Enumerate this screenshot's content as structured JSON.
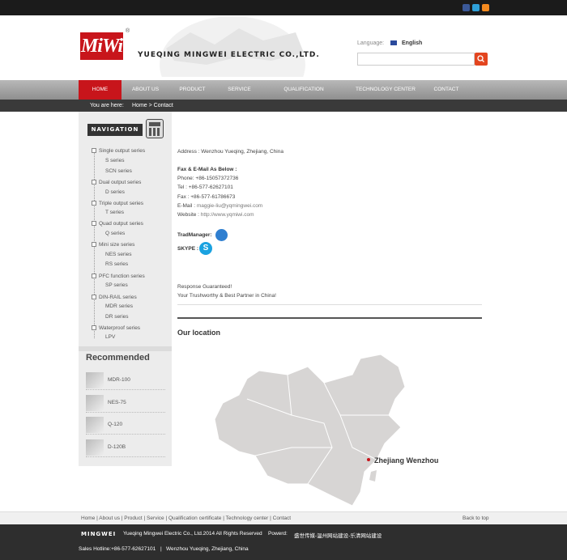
{
  "social": {
    "icons": [
      "facebook-icon",
      "twitter-icon",
      "rss-icon"
    ],
    "colors": [
      "#3b5998",
      "#2fa0d8",
      "#f58a1f"
    ]
  },
  "header": {
    "logo_text": "MiWi",
    "registered_mark": "®",
    "company_name": "YUEQING MINGWEI ELECTRIC CO.,LTD.",
    "language_label": "Language:",
    "language_value": "English",
    "search_placeholder": ""
  },
  "nav": {
    "items": [
      "HOME",
      "ABOUT US",
      "PRODUCT",
      "SERVICE",
      "QUALIFICATION CERTIFICATE",
      "TECHNOLOGY CENTER",
      "CONTACT"
    ],
    "active": "HOME",
    "accent": "#c8151b"
  },
  "breadcrumb": {
    "label": "You are here:",
    "path": "Home > Contact"
  },
  "sidebar": {
    "navigation_title": "NAVIGATION",
    "categories": [
      {
        "name": "Single output series",
        "children": [
          "S series",
          "SCN series"
        ]
      },
      {
        "name": "Dual output series",
        "children": [
          "D series"
        ]
      },
      {
        "name": "Triple output series",
        "children": [
          "T series"
        ]
      },
      {
        "name": "Quad output series",
        "children": [
          "Q series"
        ]
      },
      {
        "name": "Mini size series",
        "children": [
          "NES series",
          "RS series"
        ]
      },
      {
        "name": "PFC function series",
        "children": [
          "SP series"
        ]
      },
      {
        "name": "DIN-RAIL series",
        "children": [
          "MDR series",
          "DR series"
        ]
      },
      {
        "name": "Waterproof series",
        "children": [
          "LPV"
        ]
      }
    ],
    "recommended_title": "Recommended",
    "recommended": [
      "MDR-100",
      "NES-75",
      "Q-120",
      "D-120B"
    ]
  },
  "contact": {
    "address": "Address : Wenzhou Yueqing, Zhejiang, China",
    "fax_email_title": "Fax & E-Mail As Below :",
    "phone": "Phone: +86-15057372736",
    "tel": "Tel : +86-577-62627101",
    "fax": "Fax : +86-577-61786673",
    "email_label": "E-Mail :",
    "email": "maggie-liu@yqmingwei.com",
    "website_label": "Website :",
    "website": "http://www.yqmiwi.com",
    "tradmanager": "TradManager:",
    "skype": "SKYPE :",
    "response1": "Response Guaranteed!",
    "response2": "Your Trushworthy & Best Partner in China!",
    "location_title": "Our location",
    "city": "Zhejiang Wenzhou"
  },
  "footer": {
    "links": [
      "Home",
      "About us",
      "Product",
      "Service",
      "Qualification certificate",
      "Technology center",
      "Contact"
    ],
    "back_to_top": "Back to top",
    "brand": "MINGWEI",
    "copyright": "Yueqing Mingwei Electric Co., Ltd.2014 All Rights Reserved",
    "powered_label": "Powerd:",
    "powered_value": "盛世传媒-温州网站建设-乐清网站建设",
    "hotline": "Sales Hotline:+86-577-62627101",
    "separator": "|",
    "location": "Wenzhou Yueqing, Zhejiang, China"
  }
}
